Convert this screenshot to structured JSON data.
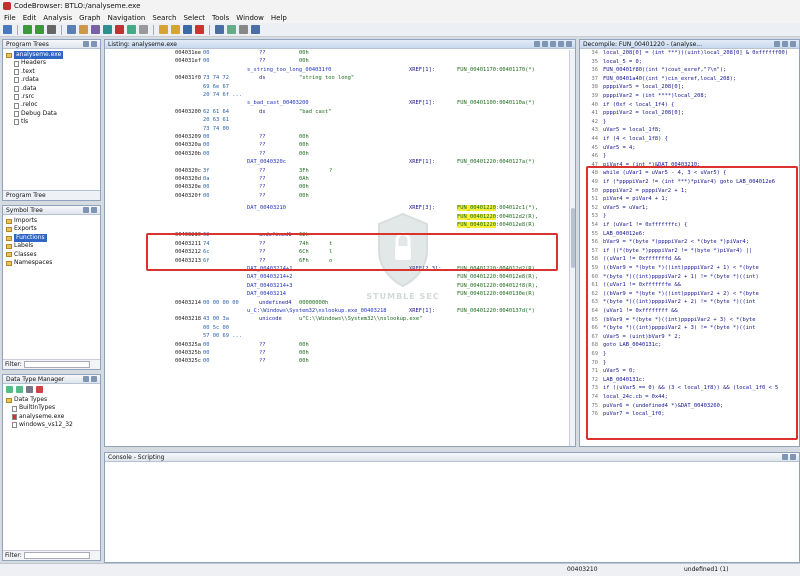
{
  "window": {
    "title": "CodeBrowser: BTLO:/analyseme.exe"
  },
  "menu": [
    "File",
    "Edit",
    "Analysis",
    "Graph",
    "Navigation",
    "Search",
    "Select",
    "Tools",
    "Window",
    "Help"
  ],
  "program_trees": {
    "title": "Program Trees",
    "root": "analyseme.exe",
    "items": [
      "Headers",
      ".text",
      ".rdata",
      ".data",
      ".rsrc",
      ".reloc",
      "Debug Data",
      "tls"
    ],
    "tab": "Program Tree"
  },
  "symbol_tree": {
    "title": "Symbol Tree",
    "items": [
      "Imports",
      "Exports",
      "Functions",
      "Labels",
      "Classes",
      "Namespaces"
    ],
    "filter_label": "Filter:"
  },
  "data_type_manager": {
    "title": "Data Type Manager",
    "items": [
      "Data Types",
      "BuiltInTypes",
      "analyseme.exe",
      "windows_vs12_32"
    ],
    "filter_label": "Filter:"
  },
  "listing": {
    "title": "Listing:  analyseme.exe",
    "rows": [
      {
        "addr": "004031ee",
        "bytes": "00",
        "mnem": "??",
        "op": "00h"
      },
      {
        "addr": "004031ef",
        "bytes": "00",
        "mnem": "??",
        "op": "00h"
      },
      {
        "label": "s_string_too_long_004031f0",
        "xref": "XREF[1]:",
        "xrv": "FUN_00401170:00401170(*)"
      },
      {
        "addr": "004031f0",
        "bytes": "73 74 72",
        "mnem": "ds",
        "op": "\"string too long\""
      },
      {
        "bytes": "69 6e 67"
      },
      {
        "bytes": "20 74 6f ..."
      },
      {
        "label": "s_bad_cast_00403200",
        "xref": "XREF[1]:",
        "xrv": "FUN_00401100:0040110a(*)"
      },
      {
        "addr": "00403200",
        "bytes": "62 61 64",
        "mnem": "ds",
        "op": "\"bad cast\""
      },
      {
        "bytes": "20 63 61"
      },
      {
        "bytes": "73 74 00"
      },
      {
        "addr": "00403209",
        "bytes": "00",
        "mnem": "??",
        "op": "00h"
      },
      {
        "addr": "0040320a",
        "bytes": "00",
        "mnem": "??",
        "op": "00h"
      },
      {
        "addr": "0040320b",
        "bytes": "00",
        "mnem": "??",
        "op": "00h"
      },
      {
        "label": "DAT_0040320c",
        "xref": "XREF[1]:",
        "xrv": "FUN_00401220:0040127a(*)"
      },
      {
        "addr": "0040320c",
        "bytes": "3f",
        "mnem": "??",
        "op": "3Fh",
        "ch": "?"
      },
      {
        "addr": "0040320d",
        "bytes": "0a",
        "mnem": "??",
        "op": "0Ah"
      },
      {
        "addr": "0040320e",
        "bytes": "00",
        "mnem": "??",
        "op": "00h"
      },
      {
        "addr": "0040320f",
        "bytes": "00",
        "mnem": "??",
        "op": "00h"
      }
    ],
    "highlight": {
      "label": "DAT_00403210",
      "xref": "XREF[3]:",
      "xrv": [
        "FUN_00401220:004012c1(*),",
        "FUN_00401220:004012d2(R),",
        "FUN_00401220:004012e8(R)"
      ],
      "hl": [
        "FUN_00401220",
        "FUN_00401220",
        "FUN_00401220"
      ]
    },
    "rows2": [
      {
        "addr": "00403210",
        "bytes": "62",
        "mnem": "undefined1",
        "op": "62h"
      },
      {
        "addr": "00403211",
        "bytes": "74",
        "mnem": "??",
        "op": "74h",
        "ch": "t"
      },
      {
        "addr": "00403212",
        "bytes": "6c",
        "mnem": "??",
        "op": "6Ch",
        "ch": "l"
      },
      {
        "addr": "00403213",
        "bytes": "6f",
        "mnem": "??",
        "op": "6Fh",
        "ch": "o"
      },
      {
        "label": "DAT_00403214+1",
        "xref": "XREF[2,3]:",
        "xrv": "FUN_00401220:004012d2(R),"
      },
      {
        "label": "DAT_00403214+2",
        "xrv": "FUN_00401220:004012e8(R),"
      },
      {
        "label": "DAT_00403214+3",
        "xrv": "FUN_00401220:004012f8(R),"
      },
      {
        "label": "DAT_00403214",
        "xrv": "FUN_00401220:0040130e(R)"
      },
      {
        "addr": "00403214",
        "bytes": "00 00 00 00",
        "mnem": "undefined4",
        "op": "00000000h"
      },
      {
        "label": "u_C:\\Windows\\System32\\nslookup.exe_00403218",
        "xref": "XREF[1]:",
        "xrv": "FUN_00401220:0040137d(*)"
      },
      {
        "addr": "00403218",
        "bytes": "43 00 3a",
        "mnem": "unicode",
        "op": "u\"C:\\\\Windows\\\\System32\\\\nslookup.exe\""
      },
      {
        "bytes": "00 5c 00"
      },
      {
        "bytes": "57 00 69 ..."
      },
      {
        "addr": "0040325a",
        "bytes": "00",
        "mnem": "??",
        "op": "00h"
      },
      {
        "addr": "0040325b",
        "bytes": "00",
        "mnem": "??",
        "op": "00h"
      },
      {
        "addr": "0040325c",
        "bytes": "00",
        "mnem": "??",
        "op": "00h"
      }
    ]
  },
  "decompile": {
    "title": "Decompile: FUN_00401220 - (analyse...",
    "lines": [
      {
        "n": "34",
        "c": "local_208[0] = (int ***)((uint)local_208[0] & 0xffffff00)"
      },
      {
        "n": "35",
        "c": "local_5 = 0;"
      },
      {
        "n": "36",
        "c": "FUN_00401f80((int *)cout_exref,\"?\\n\");"
      },
      {
        "n": "37",
        "c": "FUN_00401a40((int *)cin_exref,local_208);"
      },
      {
        "n": "38",
        "c": "ppppiVar5 = local_208[0];"
      },
      {
        "n": "39",
        "c": "ppppiVar2 = (int ****)local_208;"
      },
      {
        "n": "40",
        "c": "if (0xf < local_1f4) {"
      },
      {
        "n": "41",
        "c": "  ppppiVar2 = local_208[0];"
      },
      {
        "n": "42",
        "c": "}"
      },
      {
        "n": "43",
        "c": "uVar5 = local_1f8;"
      },
      {
        "n": "44",
        "c": "if (4 < local_1f8) {"
      },
      {
        "n": "45",
        "c": "  uVar5 = 4;"
      },
      {
        "n": "46",
        "c": "}"
      },
      {
        "n": "47",
        "c": "piVar4 = (int *)&DAT_00403210;"
      },
      {
        "n": "48",
        "c": "while (uVar1 = uVar5 - 4, 3 < uVar5) {"
      },
      {
        "n": "49",
        "c": "  if (*ppppiVar2 != (int ***)*piVar4) goto LAB_004012e6"
      },
      {
        "n": "50",
        "c": "  ppppiVar2 = ppppiVar2 + 1;"
      },
      {
        "n": "51",
        "c": "  piVar4 = piVar4 + 1;"
      },
      {
        "n": "52",
        "c": "  uVar5 = uVar1;"
      },
      {
        "n": "53",
        "c": "}"
      },
      {
        "n": "54",
        "c": "if (uVar1 != 0xfffffffc) {"
      },
      {
        "n": "55",
        "c": "LAB_004012e6:"
      },
      {
        "n": "56",
        "c": "  bVar9 = *(byte *)ppppiVar2 < *(byte *)piVar4;"
      },
      {
        "n": "57",
        "c": "  if ((*(byte *)ppppiVar2 != *(byte *)piVar4) ||"
      },
      {
        "n": "58",
        "c": "     ((uVar1 != 0xfffffffd &&"
      },
      {
        "n": "59",
        "c": "      ((bVar9 = *(byte *)((int)ppppiVar2 + 1) < *(byte"
      },
      {
        "n": "60",
        "c": "       *(byte *)((int)ppppiVar2 + 1) != *(byte *)((int)"
      },
      {
        "n": "61",
        "c": "       ((uVar1 != 0xfffffffe &&"
      },
      {
        "n": "62",
        "c": "        ((bVar9 = *(byte *)((int)ppppiVar2 + 2) < *(byte"
      },
      {
        "n": "63",
        "c": "         *(byte *)((int)ppppiVar2 + 2) != *(byte *)((int"
      },
      {
        "n": "64",
        "c": "         (uVar1 != 0xffffffff &&"
      },
      {
        "n": "65",
        "c": "         (bVar9 = *(byte *)((int)ppppiVar2 + 3) < *(byte"
      },
      {
        "n": "66",
        "c": "          *(byte *)((int)ppppiVar2 + 3) != *(byte *)((int"
      },
      {
        "n": "67",
        "c": "    uVar5 = (uint)bVar9 * 2;"
      },
      {
        "n": "68",
        "c": "    goto LAB_0040131c;"
      },
      {
        "n": "69",
        "c": "  }"
      },
      {
        "n": "70",
        "c": "}"
      },
      {
        "n": "71",
        "c": "uVar5 = 0;"
      },
      {
        "n": "72",
        "c": "LAB_0040131c:"
      },
      {
        "n": "73",
        "c": "if ((uVar5 == 0) && (3 < local_1f8)) && (local_1f0 < 5"
      },
      {
        "n": "74",
        "c": "  local_24c.cb = 0x44;"
      },
      {
        "n": "75",
        "c": "  puVar6 = (undefined4 *)&DAT_00403260;"
      },
      {
        "n": "76",
        "c": "  puVar7 = local_1f0;"
      }
    ]
  },
  "console": {
    "title": "Console - Scripting"
  },
  "watermark": {
    "line1": "STUMBLE SEC"
  },
  "status": {
    "address": "00403210",
    "type": "undefined1 (1)"
  }
}
